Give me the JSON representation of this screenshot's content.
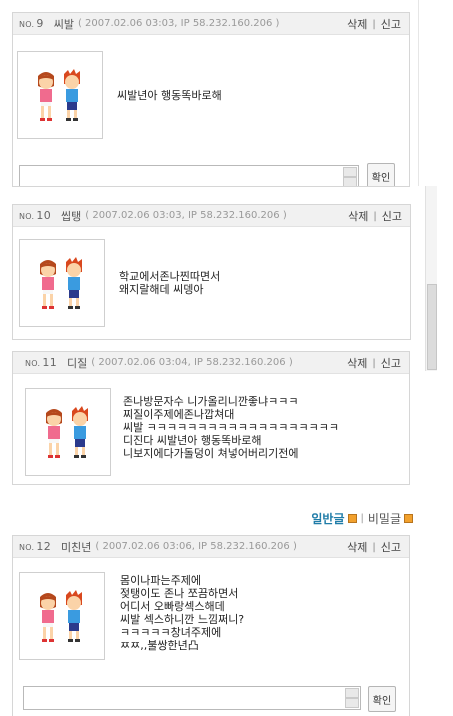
{
  "posts": [
    {
      "no_prefix": "NO.",
      "no": "9",
      "name": "씨발",
      "meta": "( 2007.02.06 03:03, IP 58.232.160.206 )",
      "delete_label": "삭제",
      "reply_label": "신고",
      "message": "씨발년아 행동똑바로해",
      "confirm_label": "확인"
    },
    {
      "no_prefix": "NO.",
      "no": "10",
      "name": "씹탱",
      "meta": "( 2007.02.06 03:03, IP 58.232.160.206 )",
      "delete_label": "삭제",
      "reply_label": "신고",
      "message": "학교에서존나찐따면서\n왜지랄해데 씨뎅아"
    },
    {
      "no_prefix": "NO.",
      "no": "11",
      "name": "디질",
      "meta": "( 2007.02.06 03:04, IP 58.232.160.206 )",
      "delete_label": "삭제",
      "reply_label": "신고",
      "message": "존나방문자수 니가올리니깐좋냐ㅋㅋㅋ\n찌질이주제에존나깝쳐대\n씨발 ㅋㅋㅋㅋㅋㅋㅋㅋㅋㅋㅋㅋㅋㅋㅋㅋㅋㅋㅋ\n디진다 씨발년아 행동똑바로해\n니보지에다가돌덩이 쳐넣어버리기전에"
    },
    {
      "no_prefix": "NO.",
      "no": "12",
      "name": "미친년",
      "meta": "( 2007.02.06 03:06, IP 58.232.160.206 )",
      "delete_label": "삭제",
      "reply_label": "신고",
      "message": "몸이나파는주제에\n젖탱이도 존나 쪼끔하면서\n어디서 오빠랑섹스해데\n씨발 섹스하니깐 느낌쩌니?\nㅋㅋㅋㅋㅋ창녀주제에\nㅉㅉ,,불쌍한년凸",
      "confirm_label": "확인"
    }
  ],
  "write_types": {
    "general": "일반글",
    "secret": "비밀글"
  },
  "colors": {
    "header_bg": "#f1f1f1",
    "general_link": "#1f7ca8",
    "square_icon": "#f2a12d"
  },
  "icons": [
    "couple-avatar-icon",
    "orange-square-icon"
  ]
}
